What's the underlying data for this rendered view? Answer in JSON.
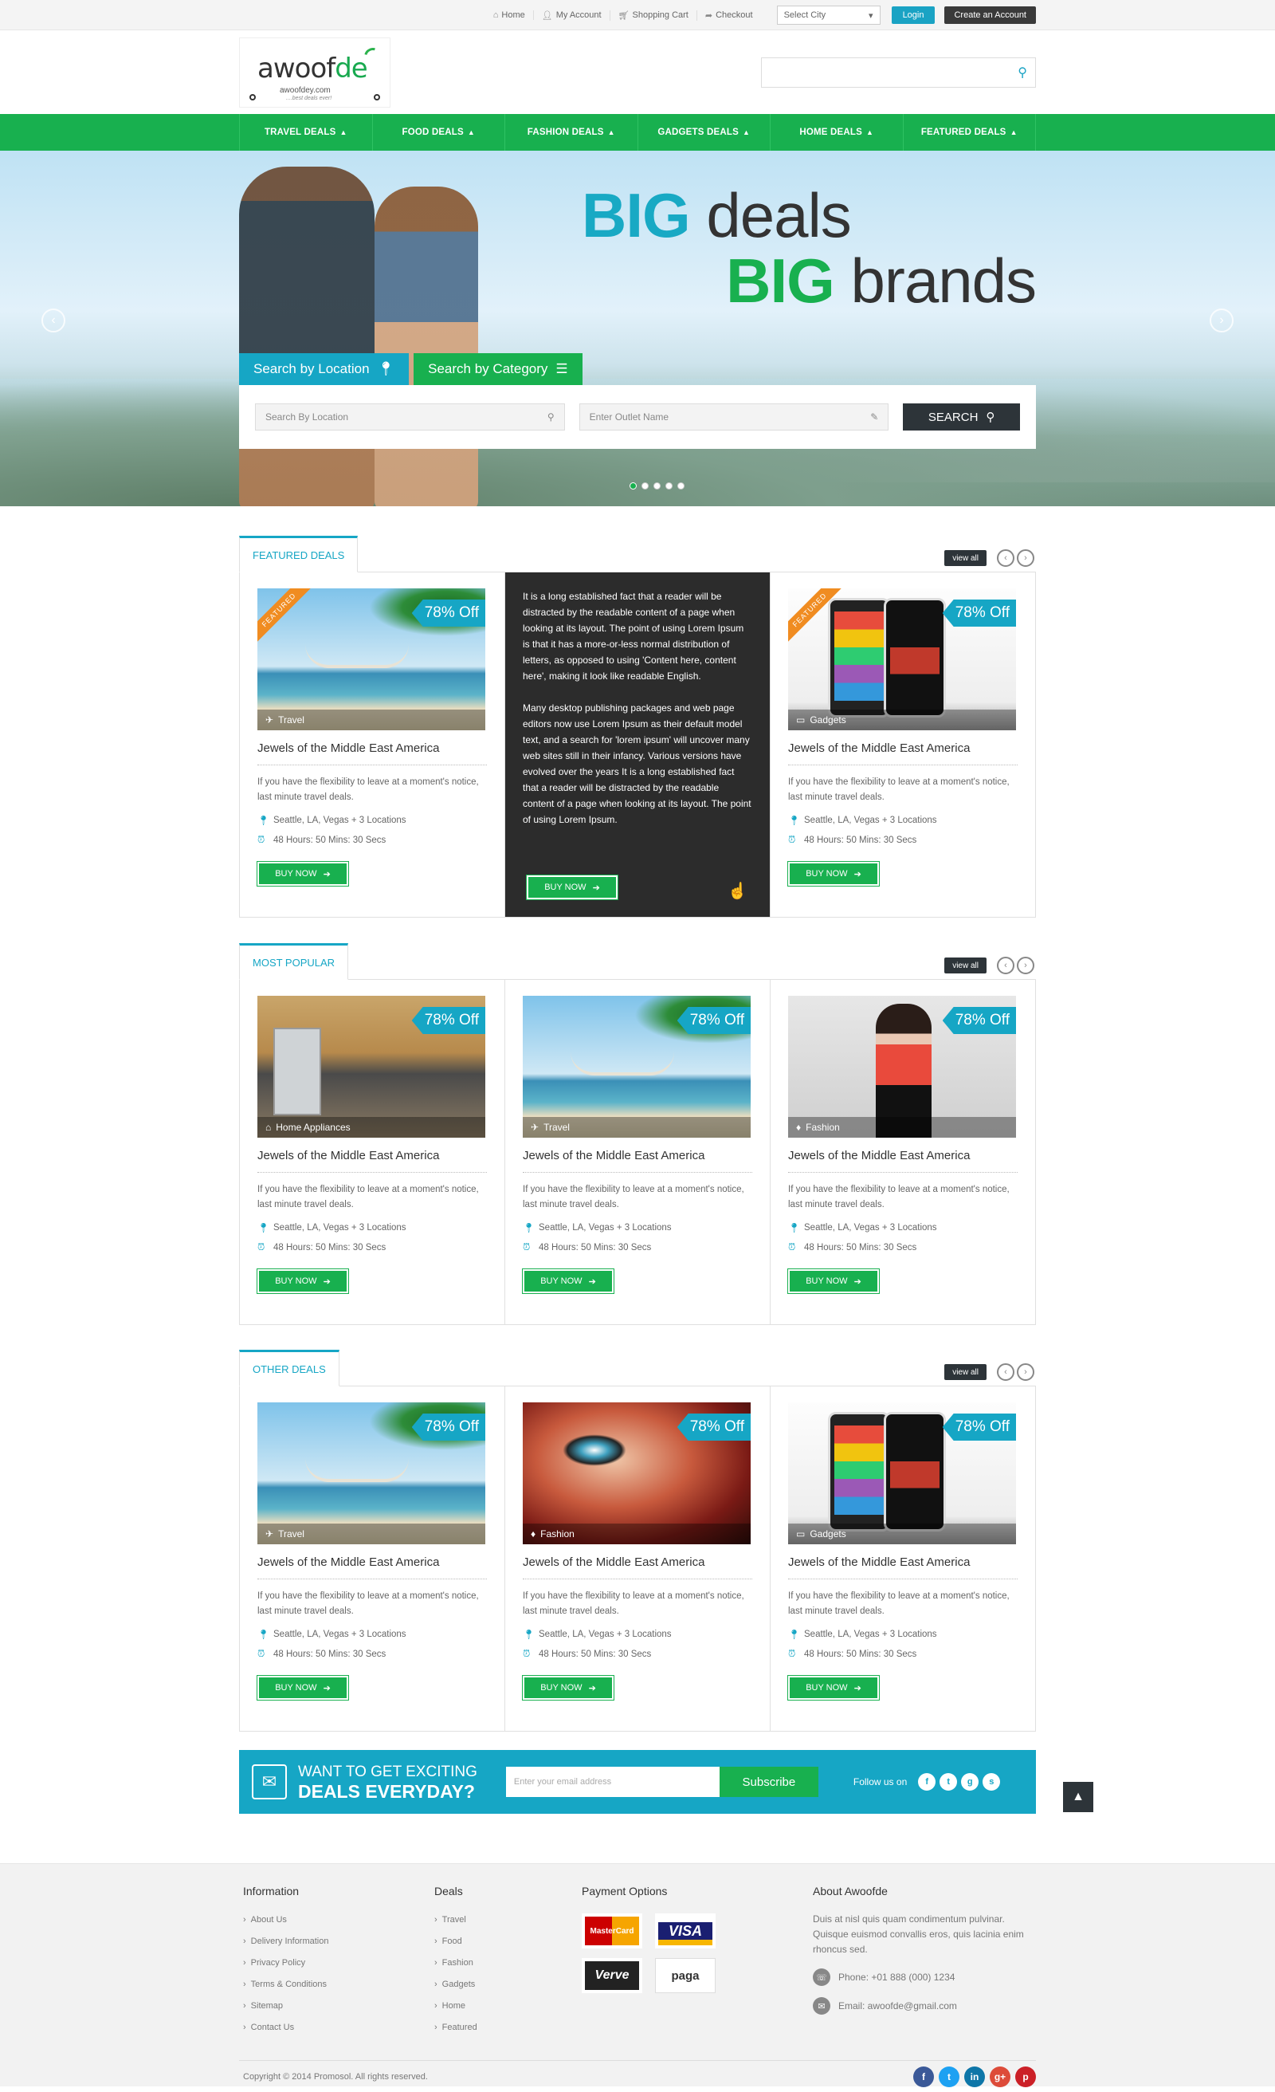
{
  "topbar": {
    "links": [
      {
        "icon": "home-icon",
        "label": "Home"
      },
      {
        "icon": "user-icon",
        "label": "My Account"
      },
      {
        "icon": "cart-icon",
        "label": "Shopping Cart"
      },
      {
        "icon": "checkout-icon",
        "label": "Checkout"
      }
    ],
    "city_select": "Select City",
    "login": "Login",
    "create_account": "Create an Account"
  },
  "header": {
    "logo_main_prefix": "awoof",
    "logo_main_suffix": "de",
    "logo_sub": "awoofdey.com",
    "logo_tag": "....best deals ever!"
  },
  "nav": [
    "TRAVEL DEALS",
    "FOOD DEALS",
    "FASHION DEALS",
    "GADGETS DEALS",
    "HOME DEALS",
    "FEATURED DEALS"
  ],
  "hero": {
    "line1_bold": "BIG",
    "line1_rest": " deals",
    "line2_bold": "BIG",
    "line2_rest": " brands",
    "tab_location": "Search by Location",
    "tab_category": "Search by Category",
    "location_placeholder": "Search By Location",
    "outlet_placeholder": "Enter Outlet Name",
    "search_button": "SEARCH",
    "slide_count": 5,
    "active_slide": 1
  },
  "sections": [
    {
      "title": "FEATURED DEALS",
      "view_all": "view all",
      "cards": [
        {
          "image": "travel",
          "featured": true,
          "discount": "78% Off",
          "category": "Travel",
          "title": "Jewels of the Middle East America",
          "desc": "If you have the flexibility to leave at a moment's notice, last minute travel deals.",
          "locations": "Seattle, LA, Vegas + 3 Locations",
          "time": "48 Hours: 50 Mins: 30 Secs",
          "buy": "BUY NOW"
        },
        {
          "hover": true,
          "hover_p1": "It is a long established fact that a reader will be distracted by the readable content of a page when looking at its layout. The point of using Lorem Ipsum is that it has a more-or-less normal distribution of letters, as opposed to using 'Content here, content here', making it look like readable English.",
          "hover_p2": "Many desktop publishing packages and web page editors now use Lorem Ipsum as their default model text, and a search for 'lorem ipsum' will uncover many web sites still in their infancy. Various versions have evolved over the years It is a long established fact that a reader will be distracted by the readable content of a page when looking at its layout. The point of using Lorem Ipsum.",
          "buy": "BUY NOW"
        },
        {
          "image": "gadgets",
          "featured": true,
          "discount": "78% Off",
          "category": "Gadgets",
          "title": "Jewels of the Middle East America",
          "desc": "If you have the flexibility to leave at a moment's notice, last minute travel deals.",
          "locations": "Seattle, LA, Vegas + 3 Locations",
          "time": "48 Hours: 50 Mins: 30 Secs",
          "buy": "BUY NOW"
        }
      ]
    },
    {
      "title": "MOST POPULAR",
      "view_all": "view all",
      "cards": [
        {
          "image": "home",
          "discount": "78% Off",
          "category": "Home Appliances",
          "title": "Jewels of the Middle East America",
          "desc": "If you have the flexibility to leave at a moment's notice, last minute travel deals.",
          "locations": "Seattle, LA, Vegas + 3 Locations",
          "time": "48 Hours: 50 Mins: 30 Secs",
          "buy": "BUY NOW"
        },
        {
          "image": "travel",
          "discount": "78% Off",
          "category": "Travel",
          "title": "Jewels of the Middle East America",
          "desc": "If you have the flexibility to leave at a moment's notice, last minute travel deals.",
          "locations": "Seattle, LA, Vegas + 3 Locations",
          "time": "48 Hours: 50 Mins: 30 Secs",
          "buy": "BUY NOW"
        },
        {
          "image": "fashion",
          "discount": "78% Off",
          "category": "Fashion",
          "title": "Jewels of the Middle East America",
          "desc": "If you have the flexibility to leave at a moment's notice, last minute travel deals.",
          "locations": "Seattle, LA, Vegas + 3 Locations",
          "time": "48 Hours: 50 Mins: 30 Secs",
          "buy": "BUY NOW"
        }
      ]
    },
    {
      "title": "OTHER DEALS",
      "view_all": "view all",
      "cards": [
        {
          "image": "travel",
          "discount": "78% Off",
          "category": "Travel",
          "title": "Jewels of the Middle East America",
          "desc": "If you have the flexibility to leave at a moment's notice, last minute travel deals.",
          "locations": "Seattle, LA, Vegas + 3 Locations",
          "time": "48 Hours: 50 Mins: 30 Secs",
          "buy": "BUY NOW"
        },
        {
          "image": "fashion2",
          "discount": "78% Off",
          "category": "Fashion",
          "title": "Jewels of the Middle East America",
          "desc": "If you have the flexibility to leave at a moment's notice, last minute travel deals.",
          "locations": "Seattle, LA, Vegas + 3 Locations",
          "time": "48 Hours: 50 Mins: 30 Secs",
          "buy": "BUY NOW"
        },
        {
          "image": "gadgets",
          "discount": "78% Off",
          "category": "Gadgets",
          "title": "Jewels of the Middle East America",
          "desc": "If you have the flexibility to leave at a moment's notice, last minute travel deals.",
          "locations": "Seattle, LA, Vegas + 3 Locations",
          "time": "48 Hours: 50 Mins: 30 Secs",
          "buy": "BUY NOW"
        }
      ]
    }
  ],
  "featured_label": "FEATURED",
  "newsletter": {
    "line1": "WANT TO GET EXCITING",
    "line2": "DEALS EVERYDAY?",
    "placeholder": "Enter your email address",
    "button": "Subscribe",
    "follow": "Follow us on"
  },
  "footer": {
    "information": {
      "title": "Information",
      "links": [
        "About Us",
        "Delivery Information",
        "Privacy Policy",
        "Terms & Conditions",
        "Sitemap",
        "Contact Us"
      ]
    },
    "deals": {
      "title": "Deals",
      "links": [
        "Travel",
        "Food",
        "Fashion",
        "Gadgets",
        "Home",
        "Featured"
      ]
    },
    "payment": {
      "title": "Payment Options",
      "cards": [
        "MasterCard",
        "VISA",
        "Verve",
        "paga"
      ]
    },
    "about": {
      "title": "About Awoofde",
      "text": "Duis at nisl quis quam condimentum pulvinar. Quisque euismod convallis eros, quis lacinia enim rhoncus sed.",
      "phone": "Phone: +01 888 (000) 1234",
      "email": "Email: awoofde@gmail.com"
    },
    "copyright": "Copyright © 2014 Promosol. All rights reserved."
  },
  "colors": {
    "green": "#18b04f",
    "blue": "#16a6c5",
    "dark": "#2d3439"
  }
}
